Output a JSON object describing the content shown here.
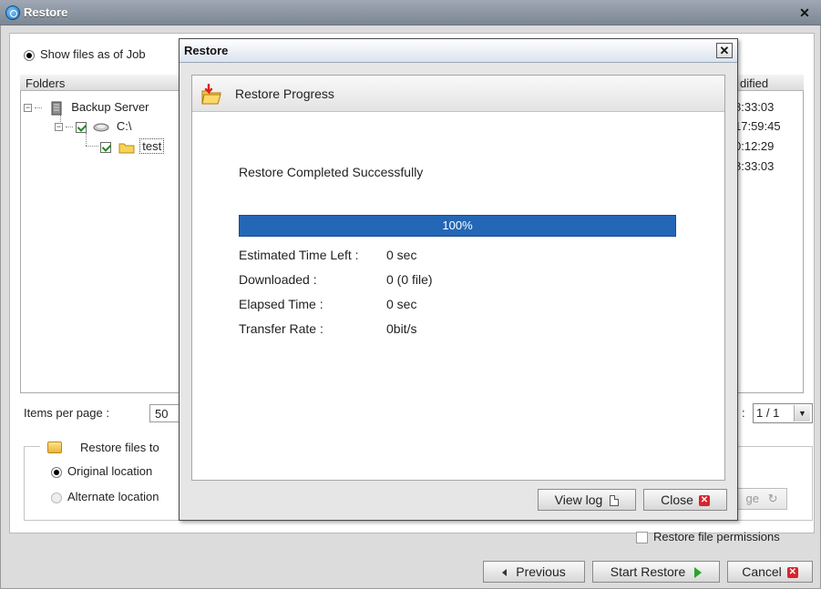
{
  "window": {
    "title": "Restore",
    "close_glyph": "✕"
  },
  "options": {
    "show_files_label": "Show files as of Job"
  },
  "tree": {
    "header": "Folders",
    "modified_header": "dified",
    "nodes": [
      {
        "label": "Backup Server"
      },
      {
        "label": "C:\\"
      },
      {
        "label": "test"
      }
    ],
    "times": [
      "8:33:03",
      "17:59:45",
      "0:12:29",
      "8:33:03"
    ]
  },
  "pager": {
    "items_per_page_label": "Items per page :",
    "items_per_page_value": "50",
    "page_colon": ":",
    "page_value": "1 / 1"
  },
  "restore_to": {
    "label": "Restore files to",
    "original": "Original location",
    "alternate": "Alternate location",
    "change_label": "ge"
  },
  "permissions_label": "Restore file permissions",
  "buttons": {
    "previous": "Previous",
    "start_restore": "Start Restore",
    "cancel": "Cancel"
  },
  "dialog": {
    "title": "Restore",
    "close_glyph": "✕",
    "header": "Restore Progress",
    "status": "Restore Completed Successfully",
    "progress_percent": 100,
    "progress_label": "100%",
    "fields": [
      {
        "label": "Estimated Time Left :",
        "value": "0 sec"
      },
      {
        "label": "Downloaded :",
        "value": "0 (0 file)"
      },
      {
        "label": "Elapsed Time :",
        "value": "0 sec"
      },
      {
        "label": "Transfer Rate :",
        "value": "0bit/s"
      }
    ],
    "view_log": "View log",
    "close": "Close"
  },
  "icons": {
    "app": "app-logo-icon",
    "server": "server-icon",
    "drive": "drive-icon",
    "folder": "folder-icon",
    "restore_progress": "restore-folder-icon"
  },
  "colors": {
    "progress": "#2467b6",
    "title_bar": "#8a94a1",
    "close_red": "#d9232b",
    "play_green": "#2aa52a"
  }
}
